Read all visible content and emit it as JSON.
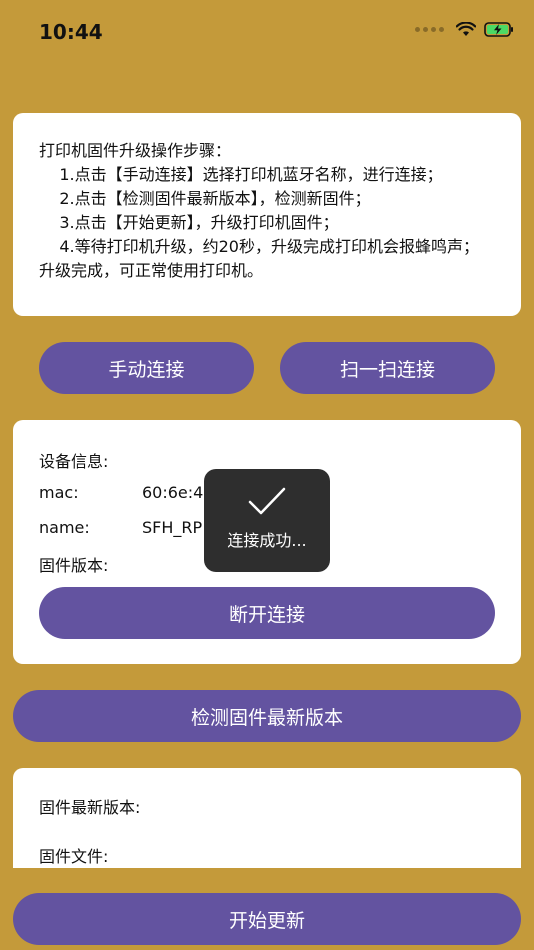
{
  "status": {
    "time": "10:44"
  },
  "steps": {
    "text": "打印机固件升级操作步骤：\n    1.点击【手动连接】选择打印机蓝牙名称，进行连接；\n    2.点击【检测固件最新版本】，检测新固件；\n    3.点击【开始更新】，升级打印机固件；\n    4.等待打印机升级，约20秒，升级完成打印机会报蜂鸣声；\n升级完成，可正常使用打印机。"
  },
  "connect": {
    "manual_label": "手动连接",
    "scan_label": "扫一扫连接"
  },
  "device": {
    "title": "设备信息:",
    "mac_label": "mac:",
    "mac_value": "60:6e:4",
    "name_label": "name:",
    "name_value": "SFH_RP",
    "firmware_label": "固件版本:",
    "disconnect_label": "断开连接"
  },
  "check_label": "检测固件最新版本",
  "firmware": {
    "latest_label": "固件最新版本:",
    "file_label": "固件文件:"
  },
  "start_label": "开始更新",
  "toast": {
    "message": "连接成功..."
  },
  "colors": {
    "background": "#C49A3A",
    "button": "#6353A0",
    "toast": "#2E2E2E"
  }
}
